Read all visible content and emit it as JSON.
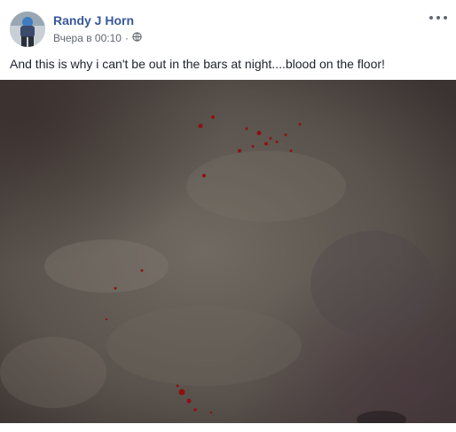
{
  "post": {
    "author": "Randy J Horn",
    "timestamp": "Вчера в 00:10",
    "separator": "·",
    "privacy_icon": "globe-icon",
    "menu_icon": "more-options-icon",
    "text": "And this is why i can't be out in the bars at night....blood on the floor!"
  },
  "colors": {
    "author_link": "#385898",
    "meta_text": "#616770",
    "body_text": "#1d2129",
    "floor": "#5f5852",
    "blood": "#8e1111"
  }
}
